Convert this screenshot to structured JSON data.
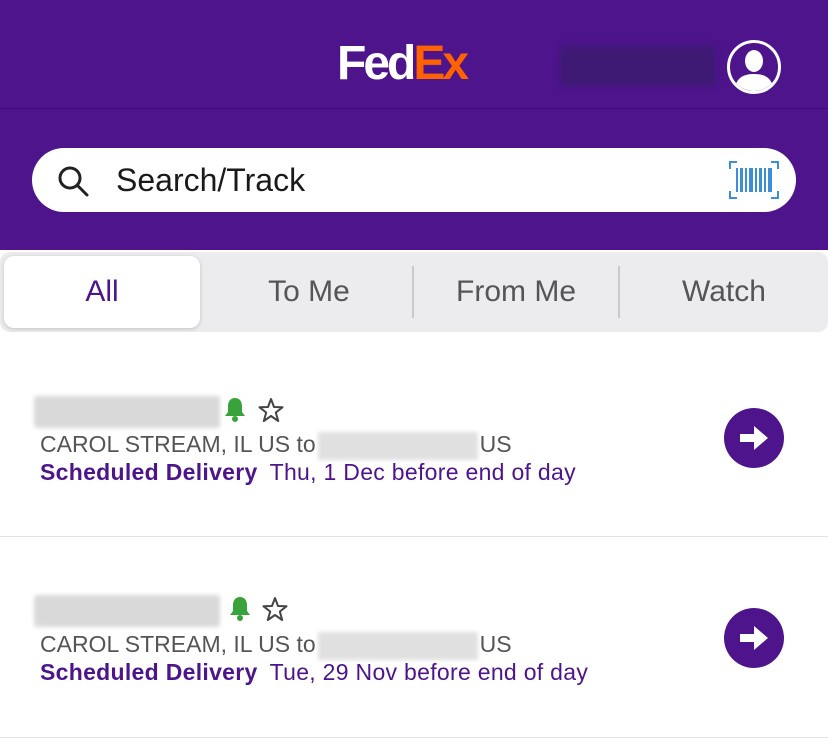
{
  "header": {
    "logo_fed": "Fed",
    "logo_ex": "Ex"
  },
  "search": {
    "placeholder": "Search/Track"
  },
  "tabs": [
    {
      "label": "All",
      "active": true
    },
    {
      "label": "To Me",
      "active": false
    },
    {
      "label": "From Me",
      "active": false
    },
    {
      "label": "Watch",
      "active": false
    }
  ],
  "shipments": [
    {
      "origin": "CAROL STREAM, IL US to",
      "destination_suffix": "US",
      "status_label": "Scheduled Delivery",
      "status_date": "Thu, 1 Dec before end of day",
      "notifications_on": true,
      "watched": false
    },
    {
      "origin": "CAROL STREAM, IL US to",
      "destination_suffix": "US",
      "status_label": "Scheduled Delivery",
      "status_date": "Tue, 29 Nov before end of day",
      "notifications_on": true,
      "watched": false
    }
  ],
  "colors": {
    "brand_purple": "#4d148c",
    "brand_orange": "#ff6200",
    "bell_green": "#3aa23a",
    "barcode_blue": "#3a8fd6"
  },
  "icons": [
    "search-icon",
    "barcode-scan-icon",
    "user-avatar-icon",
    "bell-icon",
    "star-icon",
    "arrow-right-icon"
  ]
}
